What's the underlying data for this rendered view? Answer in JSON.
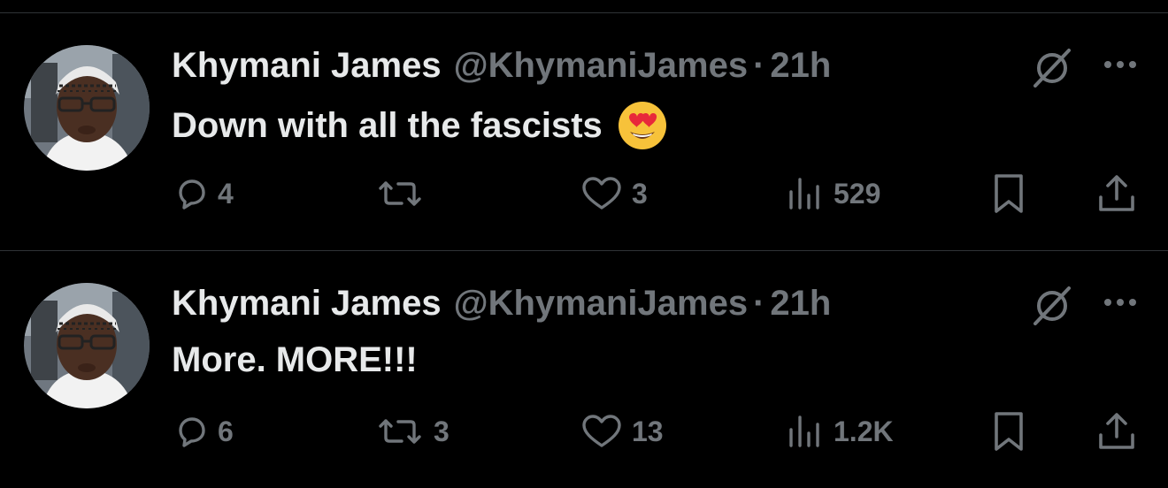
{
  "colors": {
    "background": "#000000",
    "primary_text": "#e7e9ea",
    "secondary_text": "#71767b",
    "divider": "#2f3336"
  },
  "tweets": [
    {
      "author_name": "Khymani James",
      "handle": "@KhymaniJames",
      "separator": "·",
      "time": "21h",
      "text": "Down with all the fascists",
      "emoji": "smiling-face-with-heart-eyes",
      "reply_count": "4",
      "retweet_count": "",
      "like_count": "3",
      "view_count": "529"
    },
    {
      "author_name": "Khymani James",
      "handle": "@KhymaniJames",
      "separator": "·",
      "time": "21h",
      "text": "More. MORE!!!",
      "emoji": "",
      "reply_count": "6",
      "retweet_count": "3",
      "like_count": "13",
      "view_count": "1.2K"
    }
  ],
  "icons": {
    "avatar": "avatar-photo",
    "grok": "grok-icon",
    "more": "more-dots-icon",
    "reply": "reply-bubble-icon",
    "retweet": "retweet-arrows-icon",
    "like": "heart-icon",
    "views": "views-bars-icon",
    "bookmark": "bookmark-icon",
    "share": "share-upload-icon"
  }
}
